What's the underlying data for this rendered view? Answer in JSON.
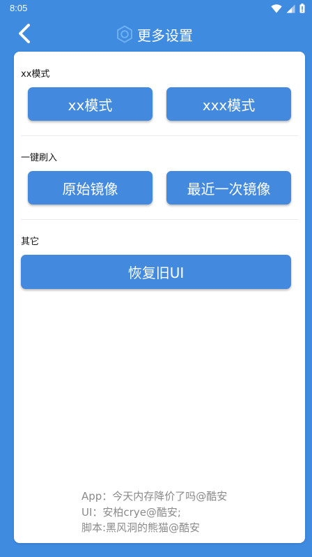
{
  "status_bar": {
    "time": "8:05",
    "icons": [
      "wifi-icon",
      "signal-icon",
      "battery-icon"
    ]
  },
  "header": {
    "title": "更多设置",
    "back_icon": "chevron-left-icon",
    "title_icon": "gear-icon"
  },
  "sections": [
    {
      "label": "xx模式",
      "buttons": [
        "xx模式",
        "xxx模式"
      ]
    },
    {
      "label": "一键刷入",
      "buttons": [
        "原始镜像",
        "最近一次镜像"
      ]
    },
    {
      "label": "其它",
      "buttons": [
        "恢复旧UI"
      ]
    }
  ],
  "footer": {
    "lines": [
      "App：今天内存降价了吗@酷安",
      "UI：安柏crye@酷安;",
      "脚本:黑风洞的熊猫@酷安"
    ]
  },
  "colors": {
    "background": "#3f8be0",
    "button": "#4389dd",
    "card": "#ffffff",
    "footer_text": "#8a8a8a"
  }
}
